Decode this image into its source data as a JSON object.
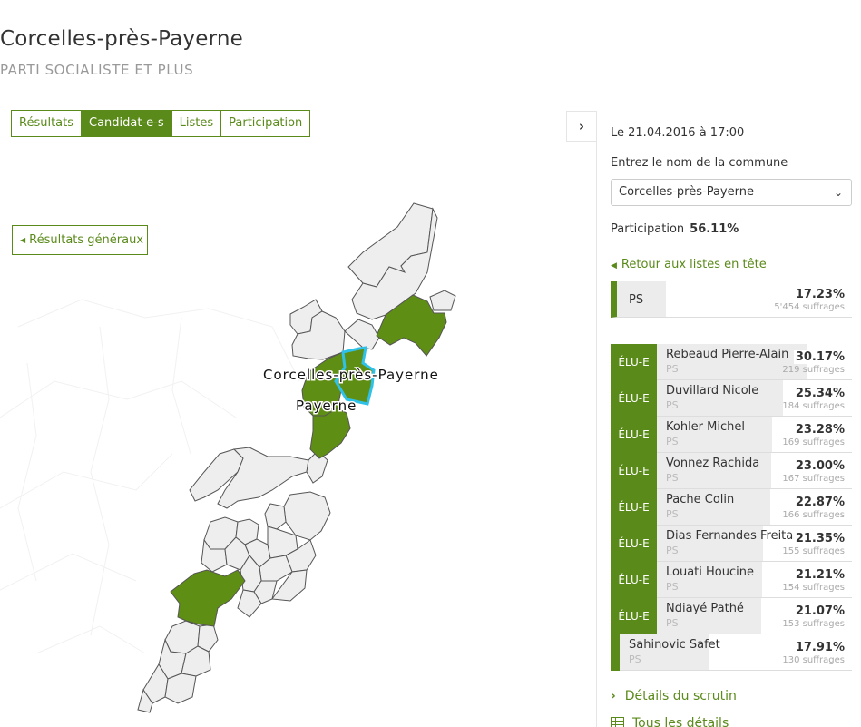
{
  "header": {
    "title": "Corcelles-près-Payerne",
    "subtitle": "PARTI SOCIALISTE ET PLUS"
  },
  "tabs": [
    {
      "label": "Résultats",
      "active": false
    },
    {
      "label": "Candidat-e-s",
      "active": true
    },
    {
      "label": "Listes",
      "active": false
    },
    {
      "label": "Participation",
      "active": false
    }
  ],
  "map": {
    "back_label": "Résultats généraux",
    "labels": {
      "selected_commune": "Corcelles-près-Payerne",
      "other_commune": "Payerne"
    },
    "colors": {
      "won": "#5f8e14",
      "other": "#eeeeee",
      "border": "#555555",
      "selected_outline": "#2fc1e8"
    }
  },
  "sidebar": {
    "date": "Le 21.04.2016 à 17:00",
    "commune_label": "Entrez le nom de la commune",
    "commune_selected": "Corcelles-près-Payerne",
    "participation_label": "Participation",
    "participation_value": "56.11%",
    "back_lists_label": "Retour aux listes en tête",
    "list": {
      "name": "PS",
      "pct": "17.23%",
      "pct_value": 17.23,
      "votes": "5'454 suffrages"
    },
    "elected_label": "ÉLU-E",
    "candidates": [
      {
        "name": "Rebeaud Pierre-Alain",
        "party": "PS",
        "pct": "30.17%",
        "pct_value": 30.17,
        "votes": "219 suffrages",
        "elected": true
      },
      {
        "name": "Duvillard Nicole",
        "party": "PS",
        "pct": "25.34%",
        "pct_value": 25.34,
        "votes": "184 suffrages",
        "elected": true
      },
      {
        "name": "Kohler Michel",
        "party": "PS",
        "pct": "23.28%",
        "pct_value": 23.28,
        "votes": "169 suffrages",
        "elected": true
      },
      {
        "name": "Vonnez Rachida",
        "party": "PS",
        "pct": "23.00%",
        "pct_value": 23.0,
        "votes": "167 suffrages",
        "elected": true
      },
      {
        "name": "Pache Colin",
        "party": "PS",
        "pct": "22.87%",
        "pct_value": 22.87,
        "votes": "166 suffrages",
        "elected": true
      },
      {
        "name": "Dias Fernandes Freitas",
        "party": "PS",
        "pct": "21.35%",
        "pct_value": 21.35,
        "votes": "155 suffrages",
        "elected": true
      },
      {
        "name": "Louati Houcine",
        "party": "PS",
        "pct": "21.21%",
        "pct_value": 21.21,
        "votes": "154 suffrages",
        "elected": true
      },
      {
        "name": "Ndiayé Pathé",
        "party": "PS",
        "pct": "21.07%",
        "pct_value": 21.07,
        "votes": "153 suffrages",
        "elected": true
      },
      {
        "name": "Sahinovic Safet",
        "party": "PS",
        "pct": "17.91%",
        "pct_value": 17.91,
        "votes": "130 suffrages",
        "elected": false
      }
    ],
    "details_label": "Détails du scrutin",
    "all_details_label": "Tous les détails"
  },
  "icons": {
    "collapse": "chevron-right-icon",
    "back": "caret-left-icon",
    "select": "chevron-down-icon",
    "details": "chevron-right-icon",
    "all_details": "table-grid-icon"
  }
}
